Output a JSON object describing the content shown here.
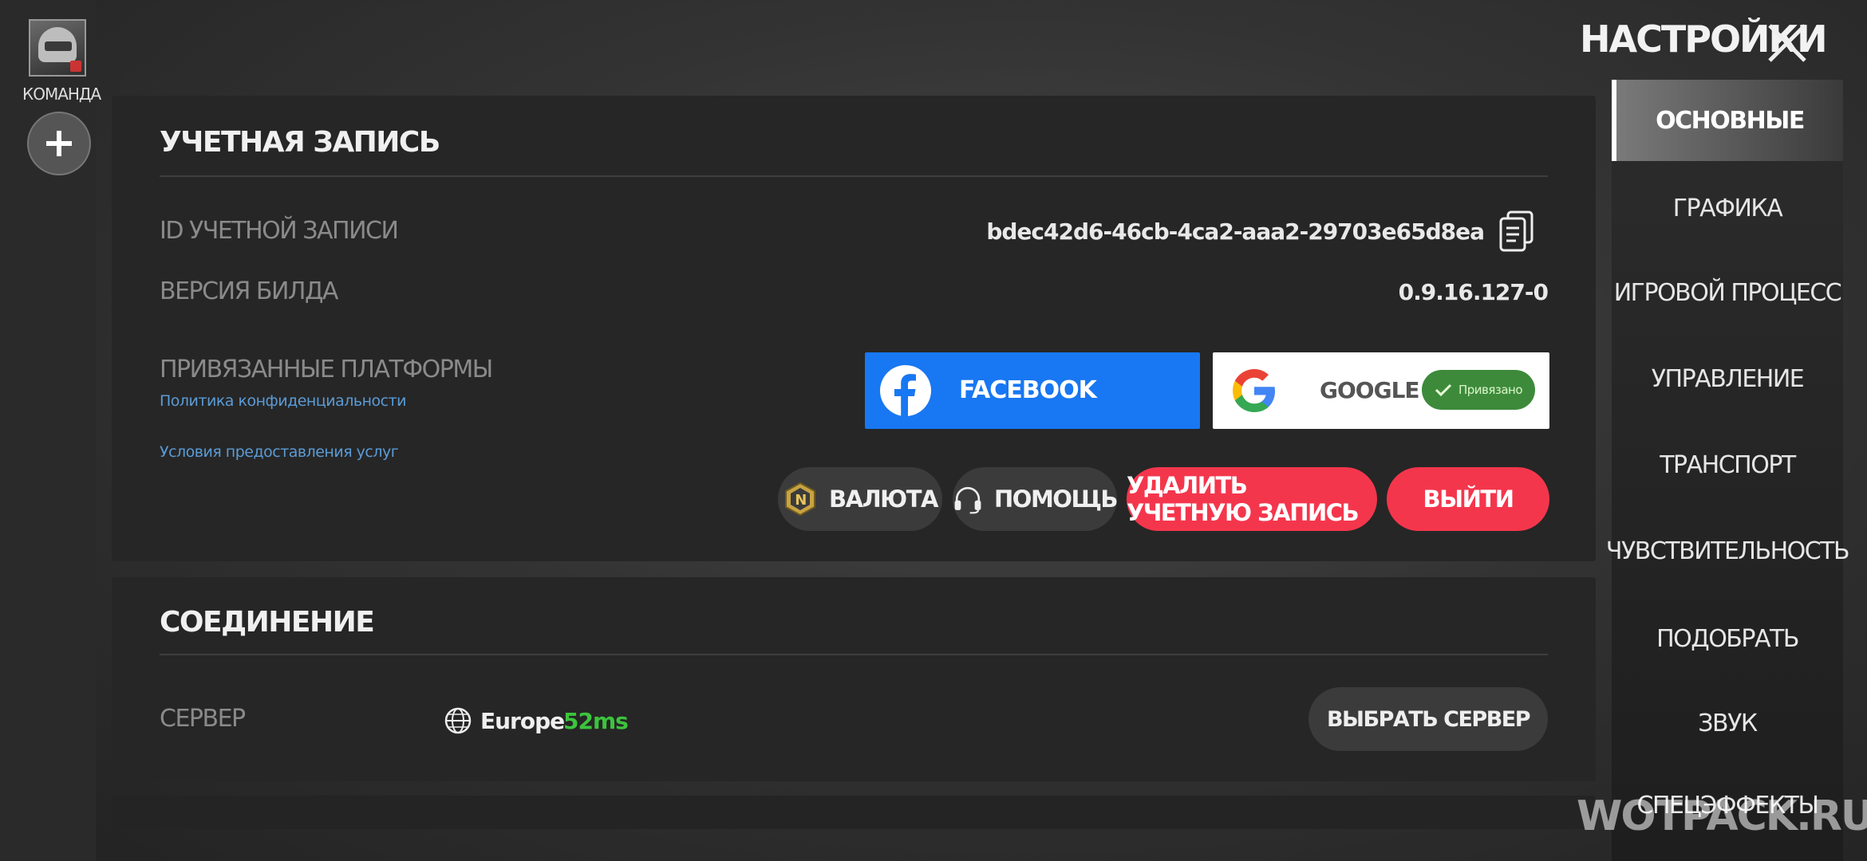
{
  "header": {
    "title": "НАСТРОЙКИ"
  },
  "left": {
    "team_label": "КОМАНДА"
  },
  "account": {
    "section_title": "УЧЕТНАЯ ЗАПИСЬ",
    "id_label": "ID УЧЕТНОЙ ЗАПИСИ",
    "id_value": "bdec42d6-46cb-4ca2-aaa2-29703e65d8ea",
    "build_label": "ВЕРСИЯ БИЛДА",
    "build_value": "0.9.16.127-0",
    "platforms_label": "ПРИВЯЗАННЫЕ ПЛАТФОРМЫ",
    "facebook_label": "FACEBOOK",
    "google_label": "GOOGLE",
    "linked_badge": "Привязано",
    "privacy_link": "Политика конфиденциальности",
    "terms_link": "Условия предоставления услуг",
    "currency_button": "ВАЛЮТА",
    "help_button": "ПОМОЩЬ",
    "delete_button": "УДАЛИТЬ УЧЕТНУЮ ЗАПИСЬ",
    "logout_button": "ВЫЙТИ"
  },
  "connection": {
    "section_title": "СОЕДИНЕНИЕ",
    "server_label": "СЕРВЕР",
    "server_name": "Europe",
    "ping": "52ms",
    "choose_button": "ВЫБРАТЬ СЕРВЕР"
  },
  "tabs": [
    {
      "label": "ОСНОВНЫЕ",
      "active": true
    },
    {
      "label": "ГРАФИКА"
    },
    {
      "label": "ИГРОВОЙ ПРОЦЕСС"
    },
    {
      "label": "УПРАВЛЕНИЕ"
    },
    {
      "label": "ТРАНСПОРТ"
    },
    {
      "label": "ЧУВСТВИТЕЛЬНОСТЬ"
    },
    {
      "label": "ПОДОБРАТЬ"
    },
    {
      "label": "ЗВУК"
    },
    {
      "label": "СПЕЦЭФФЕКТЫ"
    }
  ],
  "watermark": "WOTPACK.RU",
  "colors": {
    "facebook": "#1877f2",
    "danger": "#f4364c",
    "ping_good": "#3cc43c",
    "link": "#5b9bd5",
    "linked_badge": "#3d8a3b"
  },
  "icons": [
    "avatar",
    "plus-icon",
    "close-icon",
    "copy-icon",
    "facebook-icon",
    "google-icon",
    "check-icon",
    "currency-icon",
    "headset-icon",
    "globe-icon"
  ]
}
